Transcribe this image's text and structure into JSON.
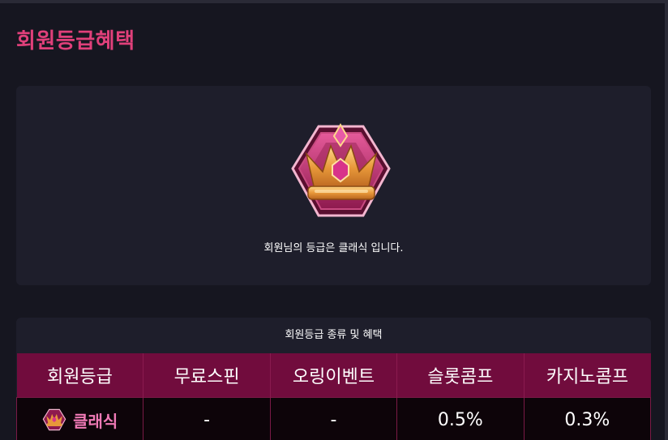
{
  "page": {
    "title": "회원등급혜택"
  },
  "current_grade": {
    "badge_icon": "crown-hexagon-badge",
    "message": "회원님의 등급은 클래식 입니다."
  },
  "benefits": {
    "caption": "회원등급 종류 및 혜택",
    "headers": [
      "회원등급",
      "무료스핀",
      "오링이벤트",
      "슬롯콤프",
      "카지노콤프"
    ],
    "rows": [
      {
        "grade": "클래식",
        "icon": "crown-badge-icon",
        "free_spin": "-",
        "oring_event": "-",
        "slot_comp": "0.5%",
        "casino_comp": "0.3%"
      }
    ]
  },
  "colors": {
    "accent": "#e0407a",
    "header_bg": "#710c3d",
    "grade_text": "#f07ab6"
  }
}
